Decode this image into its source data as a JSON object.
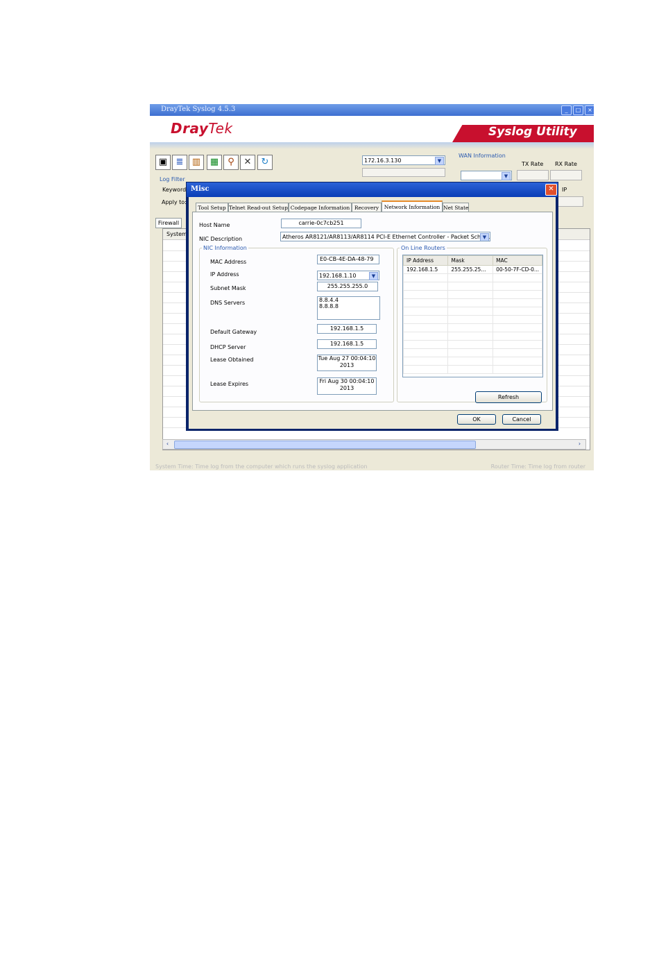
{
  "app": {
    "title": "DrayTek Syslog 4.5.3",
    "brand_dray": "Dray",
    "brand_tek": "Tek",
    "utility": "Syslog Utility",
    "router_ip": "172.16.3.130",
    "wan_info_label": "WAN Information",
    "tx_rate": "TX Rate",
    "rx_rate": "RX Rate",
    "log_filter_label": "Log Filter",
    "keyword_label": "Keyword",
    "apply_label": "Apply to:",
    "ip_label": "IP",
    "firewall_tab": "Firewall",
    "system_col": "System",
    "status_left": "System Time: Time log from the computer which runs the syslog application",
    "status_right": "Router Time: Time log from router"
  },
  "dialog": {
    "title": "Misc",
    "tabs": [
      "Tool Setup",
      "Telnet Read-out Setup",
      "Codepage Information",
      "Recovery",
      "Network Information",
      "Net State"
    ],
    "active_tab": "Network Information",
    "host_name_label": "Host Name",
    "host_name": "carrie-0c7cb251",
    "nic_desc_label": "NIC Description",
    "nic_desc": "Atheros AR8121/AR8113/AR8114 PCI-E Ethernet Controller - Packet Scheduler",
    "nic_info": {
      "legend": "NIC Information",
      "mac_label": "MAC Address",
      "mac": "E0-CB-4E-DA-48-79",
      "ip_label": "IP Address",
      "ip": "192.168.1.10",
      "mask_label": "Subnet Mask",
      "mask": "255.255.255.0",
      "dns_label": "DNS Servers",
      "dns1": "8.8.4.4",
      "dns2": "8.8.8.8",
      "gw_label": "Default Gateway",
      "gw": "192.168.1.5",
      "dhcp_label": "DHCP Server",
      "dhcp": "192.168.1.5",
      "obtained_label": "Lease Obtained",
      "obtained1": "Tue Aug 27 00:04:10",
      "obtained2": "2013",
      "expires_label": "Lease Expires",
      "expires1": "Fri Aug 30 00:04:10",
      "expires2": "2013"
    },
    "routers": {
      "legend": "On Line Routers",
      "columns": [
        "IP Address",
        "Mask",
        "MAC"
      ],
      "rows": [
        [
          "192.168.1.5",
          "255.255.25...",
          "00-50-7F-CD-0..."
        ]
      ]
    },
    "refresh": "Refresh",
    "ok": "OK",
    "cancel": "Cancel"
  }
}
